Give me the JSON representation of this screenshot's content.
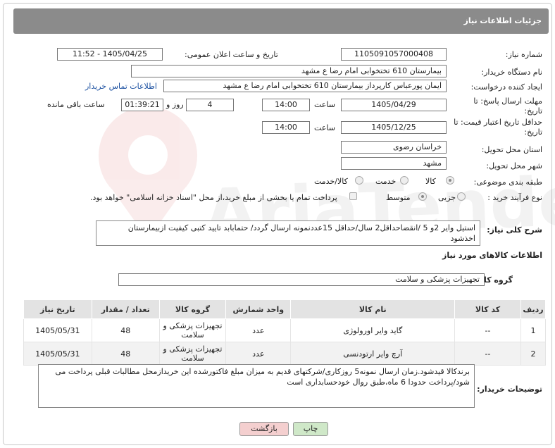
{
  "header": {
    "title": "جزئیات اطلاعات نیاز"
  },
  "fields": {
    "need_number_label": "شماره نیاز:",
    "need_number": "1105091057000408",
    "announce_label": "تاریخ و ساعت اعلان عمومی:",
    "announce_value": "1405/04/25 - 11:52",
    "buyer_org_label": "نام دستگاه خریدار:",
    "buyer_org": "بیمارستان 610 تختخوابی امام رضا ع  مشهد",
    "requester_label": "ایجاد کننده درخواست:",
    "requester": "ایمان پورعباس کارپرداز بیمارستان 610 تختخوابی امام رضا ع  مشهد",
    "contact_link": "اطلاعات تماس خریدار",
    "deadline_label": "مهلت ارسال پاسخ: تا تاریخ:",
    "deadline_date": "1405/04/29",
    "time_label": "ساعت",
    "deadline_time": "14:00",
    "days_value": "4",
    "days_label": "روز و",
    "remaining_time": "01:39:21",
    "remaining_label": "ساعت باقی مانده",
    "validity_label": "حداقل تاریخ اعتبار قیمت: تا تاریخ:",
    "validity_date": "1405/12/25",
    "validity_time": "14:00",
    "province_label": "استان محل تحویل:",
    "province": "خراسان رضوی",
    "city_label": "شهر محل تحویل:",
    "city": "مشهد",
    "category_label": "طبقه بندی موضوعی:",
    "category_options": [
      "کالا",
      "خدمت",
      "کالا/خدمت"
    ],
    "process_label": "نوع فرآیند خرید :",
    "process_options": [
      "جزیی",
      "متوسط"
    ],
    "payment_note": "پرداخت تمام یا بخشی از مبلغ خرید،از محل \"اسناد خزانه اسلامی\" خواهد بود."
  },
  "description": {
    "label": "شرح کلی نیاز:",
    "text": "استیل وایر 2و 5 /انقضاحداقل2 سال/حداقل 15عددنمونه ارسال گردد/ حتمابابد تایید کتبی کیفیت ازبیمارستان اخذشود"
  },
  "goods_info_title": "اطلاعات کالاهای مورد نیاز",
  "goods_group": {
    "label": "گروه کالا:",
    "value": "تجهیزات پزشکی و سلامت"
  },
  "table": {
    "headers": [
      "ردیف",
      "کد کالا",
      "نام کالا",
      "واحد شمارش",
      "گروه کالا",
      "تعداد / مقدار",
      "تاریخ نیاز"
    ],
    "rows": [
      [
        "1",
        "--",
        "گاید وایر اورولوژی",
        "عدد",
        "تجهیزات پزشکی و سلامت",
        "48",
        "1405/05/31"
      ],
      [
        "2",
        "--",
        "آرچ وایر ارتودنسی",
        "عدد",
        "تجهیزات پزشکی و سلامت",
        "48",
        "1405/05/31"
      ]
    ]
  },
  "buyer_notes": {
    "label": "توضیحات خریدار:",
    "text": "برندکالا قیدشود.زمان ارسال نمونه5 روزکاری/شرکتهای قدیم به میزان مبلغ فاکتورشده این خریدازمحل مطالبات قبلی پرداخت می شود/پرداخت حدودا 6 ماه،طبق روال خودحسابداری است"
  },
  "buttons": {
    "print": "چاپ",
    "back": "بازگشت"
  },
  "colors": {
    "header_bg": "#8b8b8b",
    "link": "#1a4fa0",
    "print_btn": "#cfe8c8",
    "back_btn": "#f4cfcf"
  }
}
